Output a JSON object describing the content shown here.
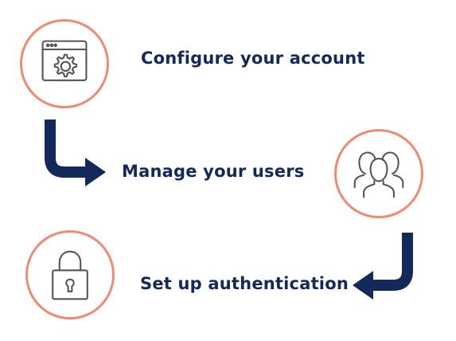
{
  "steps": [
    {
      "label": "Configure your account",
      "icon": "settings-window-icon"
    },
    {
      "label": "Manage your users",
      "icon": "users-group-icon"
    },
    {
      "label": "Set up authentication",
      "icon": "padlock-icon"
    }
  ],
  "colors": {
    "circle_border": "#f08a73",
    "text": "#13295a",
    "arrow": "#13295a",
    "icon_stroke": "#555555"
  }
}
